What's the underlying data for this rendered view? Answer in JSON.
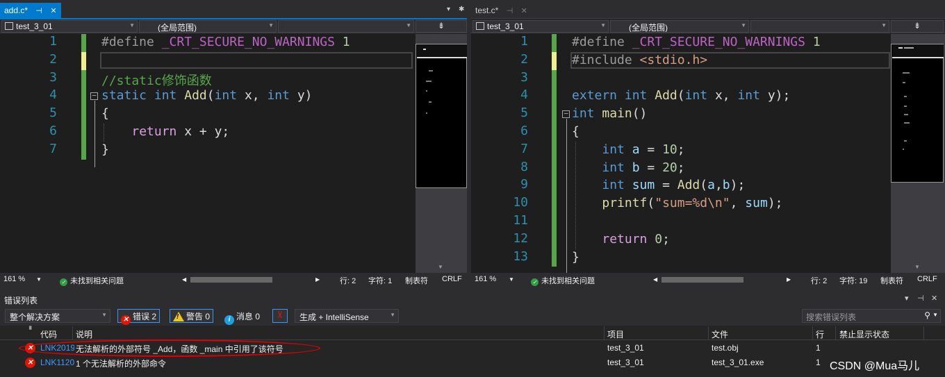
{
  "left_editor": {
    "tab": {
      "label": "add.c*",
      "pin": "⊣",
      "close": "✕"
    },
    "tab_dropdown": "▾",
    "tab_gear": "✱",
    "nav": {
      "project": "test_3_01",
      "scope": "(全局范围)",
      "member": ""
    },
    "split": "⇟",
    "line_numbers": [
      "1",
      "2",
      "3",
      "4",
      "5",
      "6",
      "7"
    ],
    "lines": [
      [
        {
          "t": "#define ",
          "c": "pp"
        },
        {
          "t": "_CRT_SECURE_NO_WARNINGS",
          "c": "mac"
        },
        {
          "t": " 1",
          "c": "num"
        }
      ],
      [],
      [
        {
          "t": "//static修饰函数",
          "c": "cm"
        }
      ],
      [
        {
          "t": "static",
          "c": "kw"
        },
        {
          "t": " "
        },
        {
          "t": "int",
          "c": "kw"
        },
        {
          "t": " "
        },
        {
          "t": "Add",
          "c": "fn"
        },
        {
          "t": "("
        },
        {
          "t": "int",
          "c": "kw"
        },
        {
          "t": " x, "
        },
        {
          "t": "int",
          "c": "kw"
        },
        {
          "t": " y)"
        }
      ],
      [
        {
          "t": "{"
        }
      ],
      [
        {
          "t": "    "
        },
        {
          "t": "return",
          "c": "ret"
        },
        {
          "t": " x + y;"
        }
      ],
      [
        {
          "t": "}"
        }
      ]
    ],
    "status": {
      "zoom": "161 %",
      "issues": "未找到相关问题",
      "line": "行: 2",
      "char": "字符: 1",
      "tabs": "制表符",
      "eol": "CRLF"
    }
  },
  "right_editor": {
    "tab": {
      "label": "test.c*",
      "pin": "⊣",
      "close": "✕"
    },
    "nav": {
      "project": "test_3_01",
      "scope": "(全局范围)",
      "member": ""
    },
    "split": "⇟",
    "line_numbers": [
      "1",
      "2",
      "3",
      "4",
      "5",
      "6",
      "7",
      "8",
      "9",
      "10",
      "11",
      "12",
      "13"
    ],
    "lines": [
      [
        {
          "t": "#define ",
          "c": "pp"
        },
        {
          "t": "_CRT_SECURE_NO_WARNINGS",
          "c": "mac"
        },
        {
          "t": " 1",
          "c": "num"
        }
      ],
      [
        {
          "t": "#include ",
          "c": "pp"
        },
        {
          "t": "<stdio.h>",
          "c": "str"
        }
      ],
      [],
      [
        {
          "t": "extern",
          "c": "kw"
        },
        {
          "t": " "
        },
        {
          "t": "int",
          "c": "kw"
        },
        {
          "t": " "
        },
        {
          "t": "Add",
          "c": "fn"
        },
        {
          "t": "("
        },
        {
          "t": "int",
          "c": "kw"
        },
        {
          "t": " x, "
        },
        {
          "t": "int",
          "c": "kw"
        },
        {
          "t": " y);"
        }
      ],
      [
        {
          "t": "int",
          "c": "kw"
        },
        {
          "t": " "
        },
        {
          "t": "main",
          "c": "fn"
        },
        {
          "t": "()"
        }
      ],
      [
        {
          "t": "{"
        }
      ],
      [
        {
          "t": "    "
        },
        {
          "t": "int",
          "c": "kw"
        },
        {
          "t": " "
        },
        {
          "t": "a",
          "c": "var"
        },
        {
          "t": " = "
        },
        {
          "t": "10",
          "c": "num"
        },
        {
          "t": ";"
        }
      ],
      [
        {
          "t": "    "
        },
        {
          "t": "int",
          "c": "kw"
        },
        {
          "t": " "
        },
        {
          "t": "b",
          "c": "var"
        },
        {
          "t": " = "
        },
        {
          "t": "20",
          "c": "num"
        },
        {
          "t": ";"
        }
      ],
      [
        {
          "t": "    "
        },
        {
          "t": "int",
          "c": "kw"
        },
        {
          "t": " "
        },
        {
          "t": "sum",
          "c": "var"
        },
        {
          "t": " = "
        },
        {
          "t": "Add",
          "c": "fn"
        },
        {
          "t": "("
        },
        {
          "t": "a",
          "c": "var"
        },
        {
          "t": ","
        },
        {
          "t": "b",
          "c": "var"
        },
        {
          "t": ");"
        }
      ],
      [
        {
          "t": "    "
        },
        {
          "t": "printf",
          "c": "fn"
        },
        {
          "t": "("
        },
        {
          "t": "\"sum=%d\\n\"",
          "c": "str"
        },
        {
          "t": ", "
        },
        {
          "t": "sum",
          "c": "var"
        },
        {
          "t": ");"
        }
      ],
      [],
      [
        {
          "t": "    "
        },
        {
          "t": "return",
          "c": "ret"
        },
        {
          "t": " "
        },
        {
          "t": "0",
          "c": "num"
        },
        {
          "t": ";"
        }
      ],
      [
        {
          "t": "}"
        }
      ]
    ],
    "status": {
      "zoom": "161 %",
      "issues": "未找到相关问题",
      "line": "行: 2",
      "char": "字符: 19",
      "tabs": "制表符",
      "eol": "CRLF"
    }
  },
  "error_list": {
    "title": "错误列表",
    "title_controls": [
      "▾",
      "⊣",
      "✕"
    ],
    "scope": "整个解决方案",
    "errors_btn": "错误 2",
    "warnings_btn": "警告 0",
    "messages_btn": "消息 0",
    "build_filter": "生成 + IntelliSense",
    "search_placeholder": "搜索错误列表",
    "columns": {
      "code": "代码",
      "desc": "说明",
      "project": "项目",
      "file": "文件",
      "line": "行",
      "suppress": "禁止显示状态"
    },
    "rows": [
      {
        "code": "LNK2019",
        "desc": "无法解析的外部符号 _Add，函数 _main 中引用了该符号",
        "project": "test_3_01",
        "file": "test.obj",
        "line": "1",
        "suppress": ""
      },
      {
        "code": "LNK1120",
        "desc": "1 个无法解析的外部命令",
        "project": "test_3_01",
        "file": "test_3_01.exe",
        "line": "1",
        "suppress": ""
      }
    ]
  },
  "watermark": "CSDN @Mua马儿"
}
